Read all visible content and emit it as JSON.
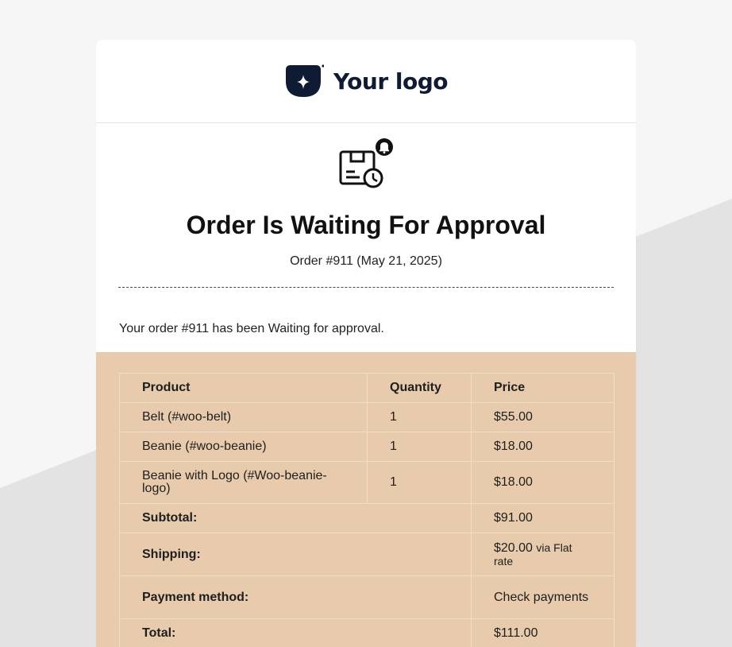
{
  "brand": {
    "logo_text": "Your logo",
    "logo_color": "#0f1a33"
  },
  "email": {
    "title": "Order Is Waiting For Approval",
    "subtitle": "Order #911 (May 21, 2025)",
    "message": "Your order #911 has been Waiting for approval.",
    "icon": "package-clock-bell-icon"
  },
  "colors": {
    "page_background": "#f6f6f6",
    "page_shape": "#e3e3e3",
    "card_background": "#ffffff",
    "order_section_background": "#e8cbac",
    "table_border": "#f2ddc7"
  },
  "order_table": {
    "headers": [
      "Product",
      "Quantity",
      "Price"
    ],
    "items": [
      {
        "product": "Belt (#woo-belt)",
        "quantity": "1",
        "price": "$55.00"
      },
      {
        "product": "Beanie (#woo-beanie)",
        "quantity": "1",
        "price": "$18.00"
      },
      {
        "product": "Beanie with Logo (#Woo-beanie-logo)",
        "quantity": "1",
        "price": "$18.00"
      }
    ],
    "totals": {
      "subtotal_label": "Subtotal:",
      "subtotal_value": "$91.00",
      "shipping_label": "Shipping:",
      "shipping_value": "$20.00",
      "shipping_method": "via Flat rate",
      "payment_label": "Payment method:",
      "payment_value": "Check payments",
      "total_label": "Total:",
      "total_value": "$111.00"
    }
  }
}
